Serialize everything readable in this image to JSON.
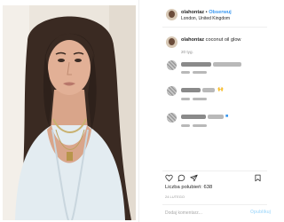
{
  "header": {
    "username": "olahontaz",
    "separator": "•",
    "follow_label": "Obserwuj",
    "location": "London, United Kingdom"
  },
  "caption": {
    "username": "olahontaz",
    "text": "coconut oil glow",
    "time": "20 tyg."
  },
  "comments": [
    {
      "icon": "blurred-text",
      "time": "..."
    },
    {
      "icon": "blurred-text",
      "time": "..."
    },
    {
      "icon": "blurred-text",
      "time": "..."
    }
  ],
  "actions": {
    "like_icon": "heart-outline-icon",
    "comment_icon": "speech-bubble-icon",
    "share_icon": "paper-plane-icon"
  },
  "likes": {
    "text": "Liczba polubień: 638"
  },
  "date": "24 LUTEGO",
  "comment_box": {
    "placeholder": "Dodaj komentarz...",
    "publish_label": "Opublikuj"
  },
  "colors": {
    "follow": "#3897f0",
    "publish_disabled": "#b2dffc",
    "text": "#262626",
    "muted": "#8e8e8e"
  }
}
